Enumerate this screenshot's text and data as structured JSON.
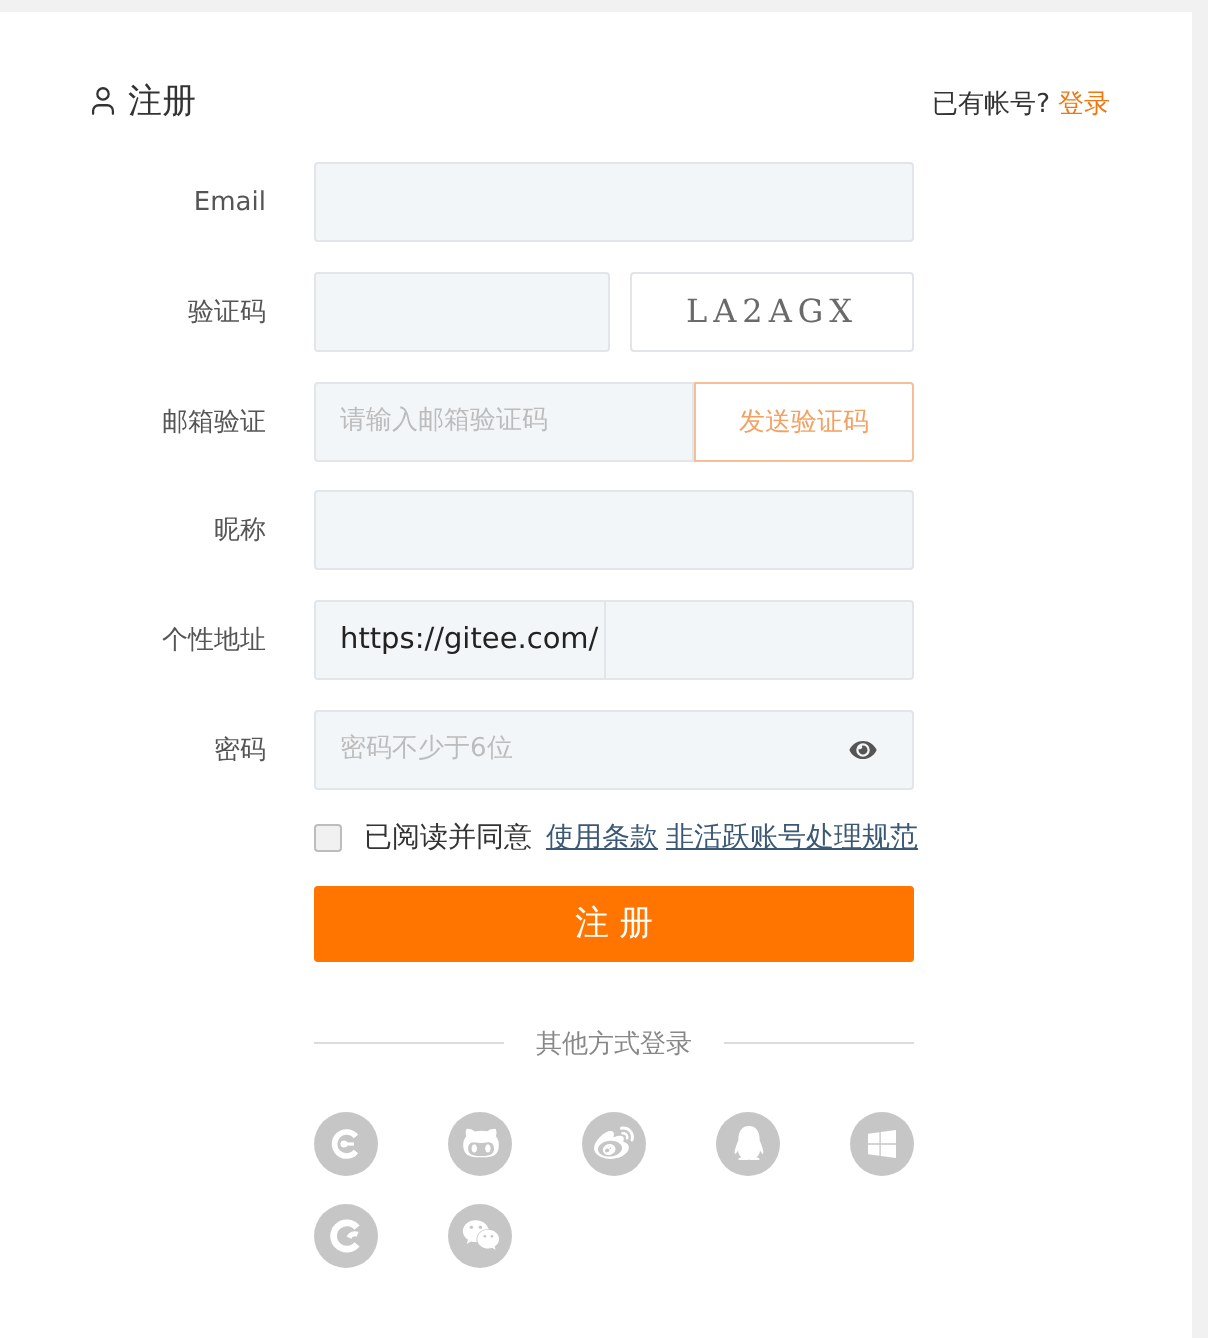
{
  "header": {
    "title": "注册",
    "prompt": "已有帐号?",
    "login_link": "登录"
  },
  "fields": [
    {
      "kind": "text",
      "label": "Email"
    },
    {
      "kind": "captcha",
      "label": "验证码",
      "captcha": "LA2AGX"
    },
    {
      "kind": "code",
      "label": "邮箱验证",
      "placeholder": "请输入邮箱验证码",
      "button": "发送验证码"
    },
    {
      "kind": "text",
      "label": "昵称"
    },
    {
      "kind": "url",
      "label": "个性地址",
      "prefix": "https://gitee.com/"
    },
    {
      "kind": "password",
      "label": "密码",
      "placeholder": "密码不少于6位"
    }
  ],
  "agreement": {
    "checked": false,
    "text": "已阅读并同意",
    "links": [
      "使用条款",
      "非活跃账号处理规范"
    ]
  },
  "submit_button": "注 册",
  "other_login": {
    "title": "其他方式登录",
    "providers": [
      {
        "kind": "c"
      },
      {
        "kind": "github"
      },
      {
        "kind": "weibo"
      },
      {
        "kind": "qq"
      },
      {
        "kind": "windows"
      },
      {
        "kind": "hook"
      },
      {
        "kind": "wechat"
      }
    ]
  }
}
